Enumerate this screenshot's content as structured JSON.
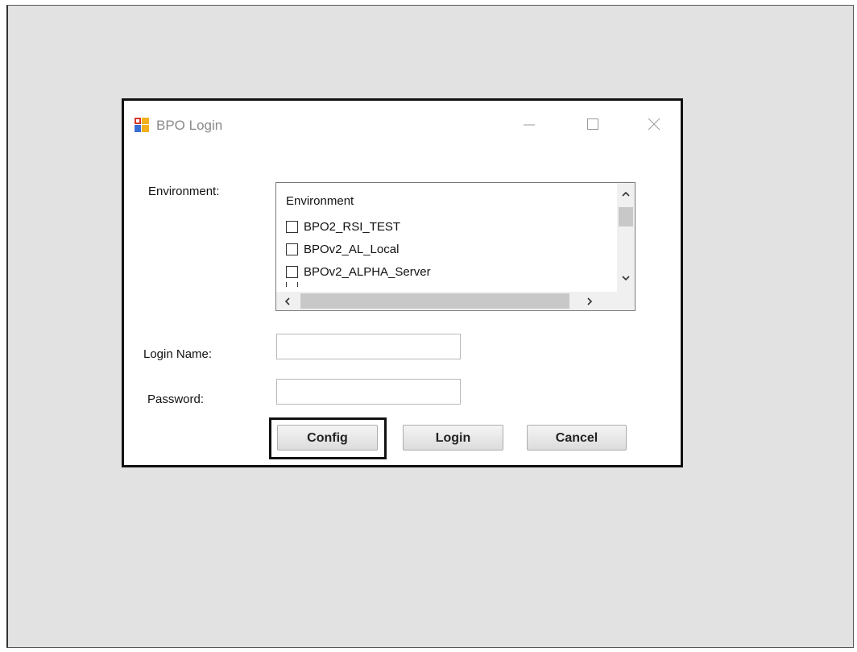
{
  "dialog": {
    "title": "BPO Login",
    "icon": "bpo-app-icon"
  },
  "environment": {
    "label": "Environment:",
    "list_header": "Environment",
    "items": [
      {
        "label": "BPO2_RSI_TEST",
        "checked": false
      },
      {
        "label": "BPOv2_AL_Local",
        "checked": false
      },
      {
        "label": "BPOv2_ALPHA_Server",
        "checked": false
      }
    ]
  },
  "login_name": {
    "label": "Login Name:",
    "value": ""
  },
  "password": {
    "label": "Password:",
    "value": ""
  },
  "buttons": {
    "config": "Config",
    "login": "Login",
    "cancel": "Cancel"
  }
}
